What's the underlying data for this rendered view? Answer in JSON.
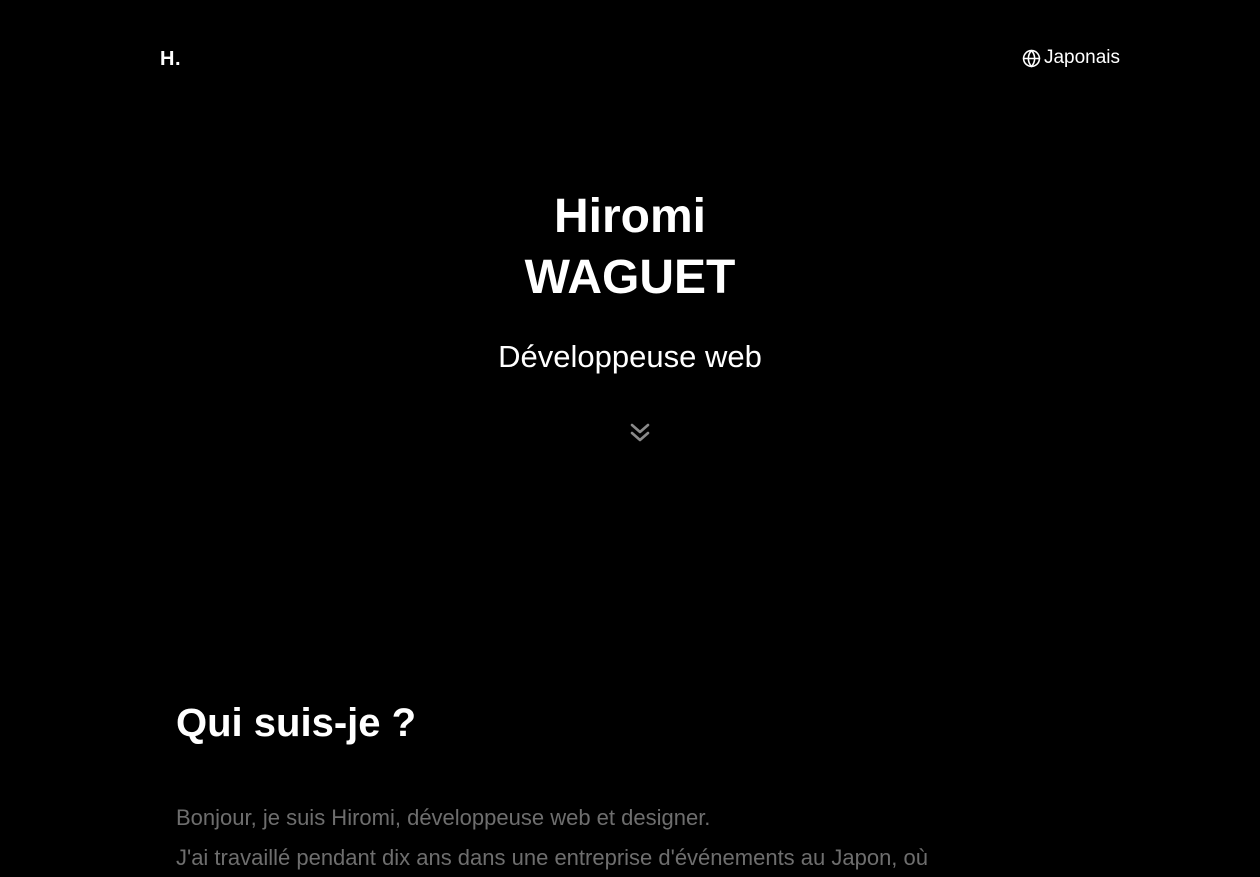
{
  "header": {
    "logo": "H.",
    "language_label": "Japonais",
    "language_icon": "globe-icon"
  },
  "hero": {
    "first_name": "Hiromi",
    "last_name": "WAGUET",
    "role": "Développeuse web",
    "scroll_icon": "double-chevron-down-icon"
  },
  "about": {
    "title": "Qui suis-je ?",
    "lines": [
      "Bonjour, je suis Hiromi, développeuse web et designer.",
      "J'ai travaillé pendant dix ans dans une entreprise d'événements au Japon, où"
    ]
  },
  "colors": {
    "background": "#000000",
    "text": "#ffffff",
    "muted_text": "#6e6e6e",
    "icon_muted": "#8a8a8a"
  }
}
